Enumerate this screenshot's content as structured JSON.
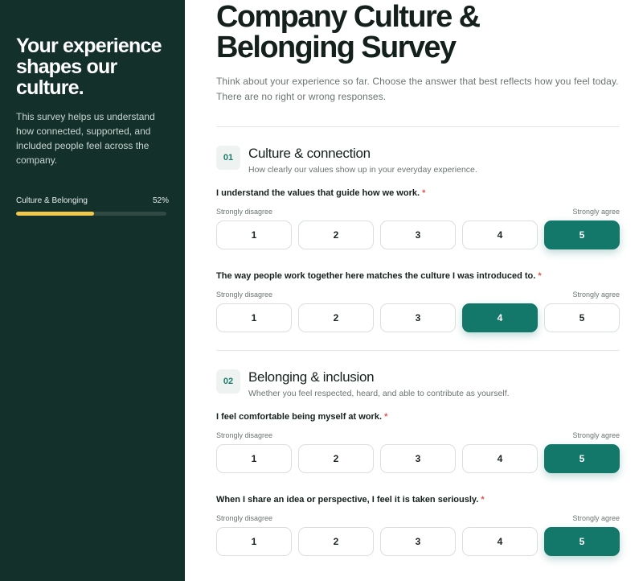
{
  "sidebar": {
    "title": "Your experience shapes our culture.",
    "description": "This survey helps us understand how connected, supported, and included people feel across the company.",
    "progress": {
      "label": "Culture & Belonging",
      "percent_text": "52%",
      "value": 0.52
    }
  },
  "header": {
    "title": "Company Culture & Belonging Survey",
    "intro": "Think about your experience so far. Choose the answer that best reflects how you feel today. There are no right or wrong responses."
  },
  "scale": {
    "low": "Strongly disagree",
    "high": "Strongly agree",
    "options": [
      "1",
      "2",
      "3",
      "4",
      "5"
    ]
  },
  "sections": [
    {
      "num": "01",
      "title": "Culture & connection",
      "subtitle": "How clearly our values show up in your everyday experience.",
      "questions": [
        {
          "text": "I understand the values that guide how we work.",
          "required": "*",
          "selected": "5"
        },
        {
          "text": "The way people work together here matches the culture I was introduced to.",
          "required": "*",
          "selected": "4"
        }
      ]
    },
    {
      "num": "02",
      "title": "Belonging & inclusion",
      "subtitle": "Whether you feel respected, heard, and able to contribute as yourself.",
      "questions": [
        {
          "text": "I feel comfortable being myself at work.",
          "required": "*",
          "selected": "5"
        },
        {
          "text": "When I share an idea or perspective, I feel it is taken seriously.",
          "required": "*",
          "selected": "5"
        }
      ]
    }
  ],
  "colors": {
    "sidebar_bg": "#14302a",
    "accent": "#13776a",
    "progress": "#f2c94c",
    "required": "#e0554c"
  }
}
